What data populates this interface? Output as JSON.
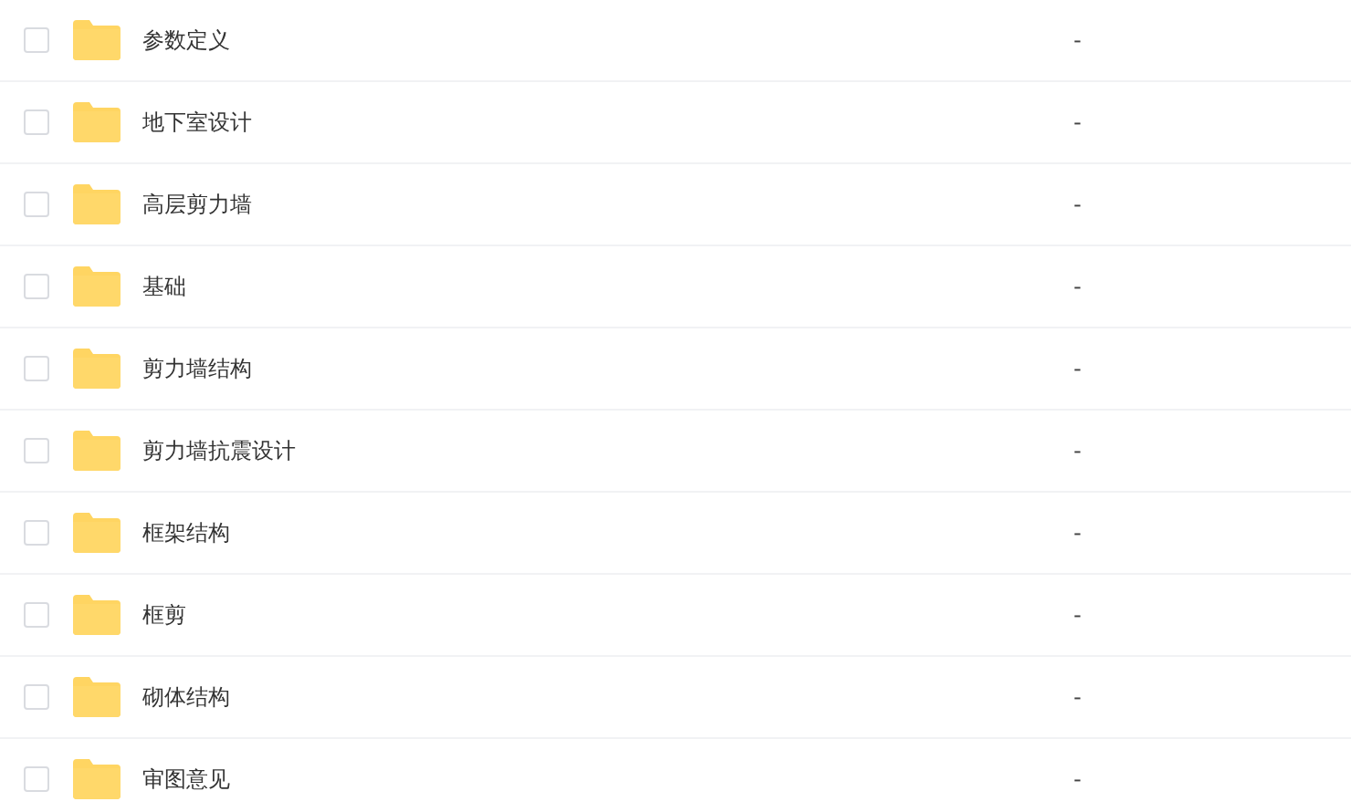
{
  "files": [
    {
      "name": "参数定义",
      "size": "-",
      "checked": false
    },
    {
      "name": "地下室设计",
      "size": "-",
      "checked": false
    },
    {
      "name": "高层剪力墙",
      "size": "-",
      "checked": false
    },
    {
      "name": "基础",
      "size": "-",
      "checked": false
    },
    {
      "name": "剪力墙结构",
      "size": "-",
      "checked": false
    },
    {
      "name": "剪力墙抗震设计",
      "size": "-",
      "checked": false
    },
    {
      "name": "框架结构",
      "size": "-",
      "checked": false
    },
    {
      "name": "框剪",
      "size": "-",
      "checked": false
    },
    {
      "name": "砌体结构",
      "size": "-",
      "checked": false
    },
    {
      "name": "审图意见",
      "size": "-",
      "checked": false
    }
  ]
}
